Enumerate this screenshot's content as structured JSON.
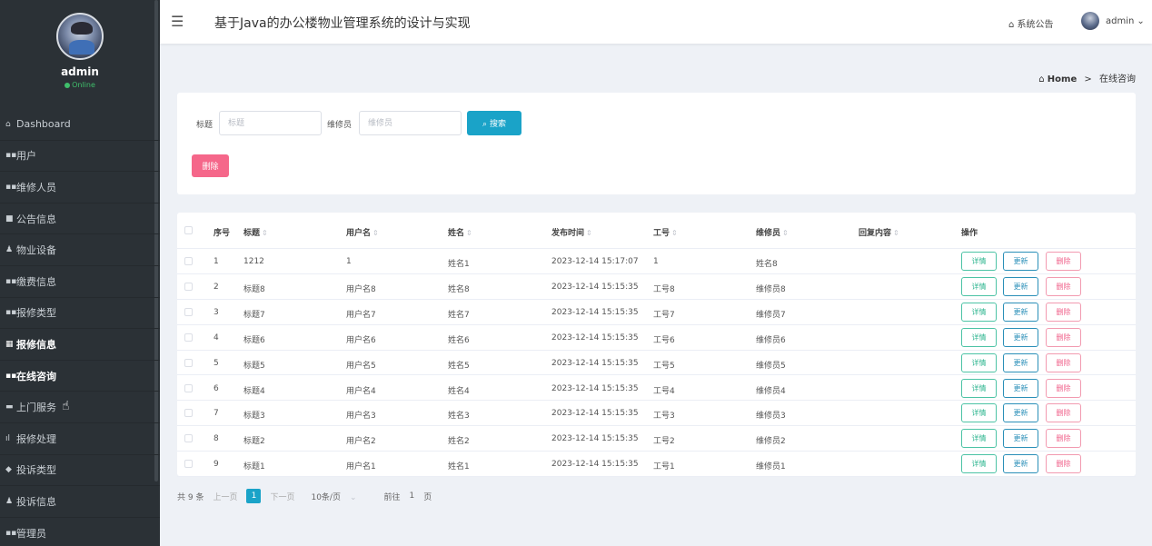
{
  "sidebar": {
    "user_name": "admin",
    "status": "Online",
    "items": [
      {
        "icon": "⌂",
        "label": "Dashboard",
        "bold": false
      },
      {
        "icon": "▪▪",
        "label": "用户",
        "bold": false
      },
      {
        "icon": "▪▪",
        "label": "维修人员",
        "bold": false
      },
      {
        "icon": "■",
        "label": "公告信息",
        "bold": false
      },
      {
        "icon": "♟",
        "label": "物业设备",
        "bold": false
      },
      {
        "icon": "▪▪",
        "label": "缴费信息",
        "bold": false
      },
      {
        "icon": "▪▪",
        "label": "报修类型",
        "bold": false
      },
      {
        "icon": "▦",
        "label": "报修信息",
        "bold": true
      },
      {
        "icon": "▪▪",
        "label": "在线咨询",
        "bold": true
      },
      {
        "icon": "▬",
        "label": "上门服务",
        "bold": false
      },
      {
        "icon": "ıl",
        "label": "报修处理",
        "bold": false
      },
      {
        "icon": "◆",
        "label": "投诉类型",
        "bold": false
      },
      {
        "icon": "♟",
        "label": "投诉信息",
        "bold": false
      },
      {
        "icon": "▪▪",
        "label": "管理员",
        "bold": false
      }
    ]
  },
  "header": {
    "title": "基于Java的办公楼物业管理系统的设计与实现",
    "notice": "系统公告",
    "user": "admin"
  },
  "breadcrumb": {
    "home": "Home",
    "separator": ">",
    "current": "在线咨询"
  },
  "search": {
    "title_label": "标题",
    "title_placeholder": "标题",
    "repair_label": "维修员",
    "repair_placeholder": "维修员",
    "search_button": "搜索",
    "delete_button": "删除"
  },
  "table": {
    "columns": [
      {
        "label": "序号",
        "sortable": false
      },
      {
        "label": "标题",
        "sortable": true
      },
      {
        "label": "用户名",
        "sortable": true
      },
      {
        "label": "姓名",
        "sortable": true
      },
      {
        "label": "发布时间",
        "sortable": true
      },
      {
        "label": "工号",
        "sortable": true
      },
      {
        "label": "维修员",
        "sortable": true
      },
      {
        "label": "回复内容",
        "sortable": true
      },
      {
        "label": "操作",
        "sortable": false
      }
    ],
    "actions": {
      "detail": "详情",
      "update": "更新",
      "delete": "删除"
    },
    "rows": [
      {
        "no": "1",
        "title": "1212",
        "username": "1",
        "name": "姓名1",
        "time": "2023-12-14 15:17:07",
        "job_no": "1",
        "repairer": "姓名8",
        "reply": ""
      },
      {
        "no": "2",
        "title": "标题8",
        "username": "用户名8",
        "name": "姓名8",
        "time": "2023-12-14 15:15:35",
        "job_no": "工号8",
        "repairer": "维修员8",
        "reply": ""
      },
      {
        "no": "3",
        "title": "标题7",
        "username": "用户名7",
        "name": "姓名7",
        "time": "2023-12-14 15:15:35",
        "job_no": "工号7",
        "repairer": "维修员7",
        "reply": ""
      },
      {
        "no": "4",
        "title": "标题6",
        "username": "用户名6",
        "name": "姓名6",
        "time": "2023-12-14 15:15:35",
        "job_no": "工号6",
        "repairer": "维修员6",
        "reply": ""
      },
      {
        "no": "5",
        "title": "标题5",
        "username": "用户名5",
        "name": "姓名5",
        "time": "2023-12-14 15:15:35",
        "job_no": "工号5",
        "repairer": "维修员5",
        "reply": ""
      },
      {
        "no": "6",
        "title": "标题4",
        "username": "用户名4",
        "name": "姓名4",
        "time": "2023-12-14 15:15:35",
        "job_no": "工号4",
        "repairer": "维修员4",
        "reply": ""
      },
      {
        "no": "7",
        "title": "标题3",
        "username": "用户名3",
        "name": "姓名3",
        "time": "2023-12-14 15:15:35",
        "job_no": "工号3",
        "repairer": "维修员3",
        "reply": ""
      },
      {
        "no": "8",
        "title": "标题2",
        "username": "用户名2",
        "name": "姓名2",
        "time": "2023-12-14 15:15:35",
        "job_no": "工号2",
        "repairer": "维修员2",
        "reply": ""
      },
      {
        "no": "9",
        "title": "标题1",
        "username": "用户名1",
        "name": "姓名1",
        "time": "2023-12-14 15:15:35",
        "job_no": "工号1",
        "repairer": "维修员1",
        "reply": ""
      }
    ]
  },
  "pagination": {
    "total": "共 9 条",
    "prev": "上一页",
    "current_page": "1",
    "next": "下一页",
    "page_size": "10条/页",
    "goto_prefix": "前往",
    "goto_value": "1",
    "goto_suffix": "页"
  }
}
